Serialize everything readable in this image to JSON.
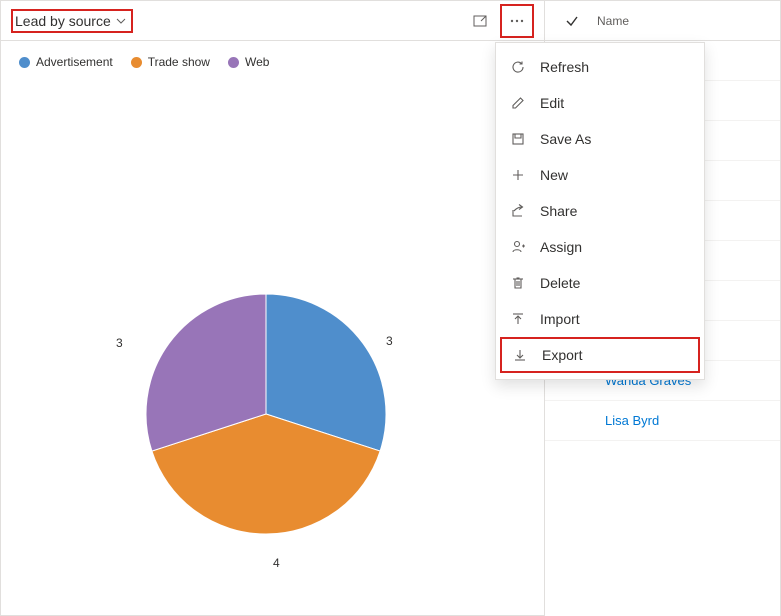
{
  "chart": {
    "title": "Lead by source",
    "legend": [
      {
        "label": "Advertisement",
        "color": "#4f8ecc"
      },
      {
        "label": "Trade show",
        "color": "#e88c30"
      },
      {
        "label": "Web",
        "color": "#9875b8"
      }
    ]
  },
  "chart_data": {
    "type": "pie",
    "title": "Lead by source",
    "categories": [
      "Advertisement",
      "Trade show",
      "Web"
    ],
    "values": [
      3,
      4,
      3
    ],
    "colors": [
      "#4f8ecc",
      "#e88c30",
      "#9875b8"
    ],
    "data_labels": [
      "3",
      "4",
      "3"
    ]
  },
  "menu": {
    "items": [
      {
        "key": "refresh",
        "label": "Refresh",
        "icon": "refresh"
      },
      {
        "key": "edit",
        "label": "Edit",
        "icon": "edit"
      },
      {
        "key": "saveas",
        "label": "Save As",
        "icon": "save"
      },
      {
        "key": "new",
        "label": "New",
        "icon": "plus"
      },
      {
        "key": "share",
        "label": "Share",
        "icon": "share"
      },
      {
        "key": "assign",
        "label": "Assign",
        "icon": "person"
      },
      {
        "key": "delete",
        "label": "Delete",
        "icon": "trash"
      },
      {
        "key": "import",
        "label": "Import",
        "icon": "import"
      },
      {
        "key": "export",
        "label": "Export",
        "icon": "export",
        "highlight": true
      }
    ]
  },
  "list": {
    "column_header": "Name",
    "items": [
      {
        "name": "Wanda Graves"
      },
      {
        "name": "Lisa Byrd"
      }
    ]
  }
}
